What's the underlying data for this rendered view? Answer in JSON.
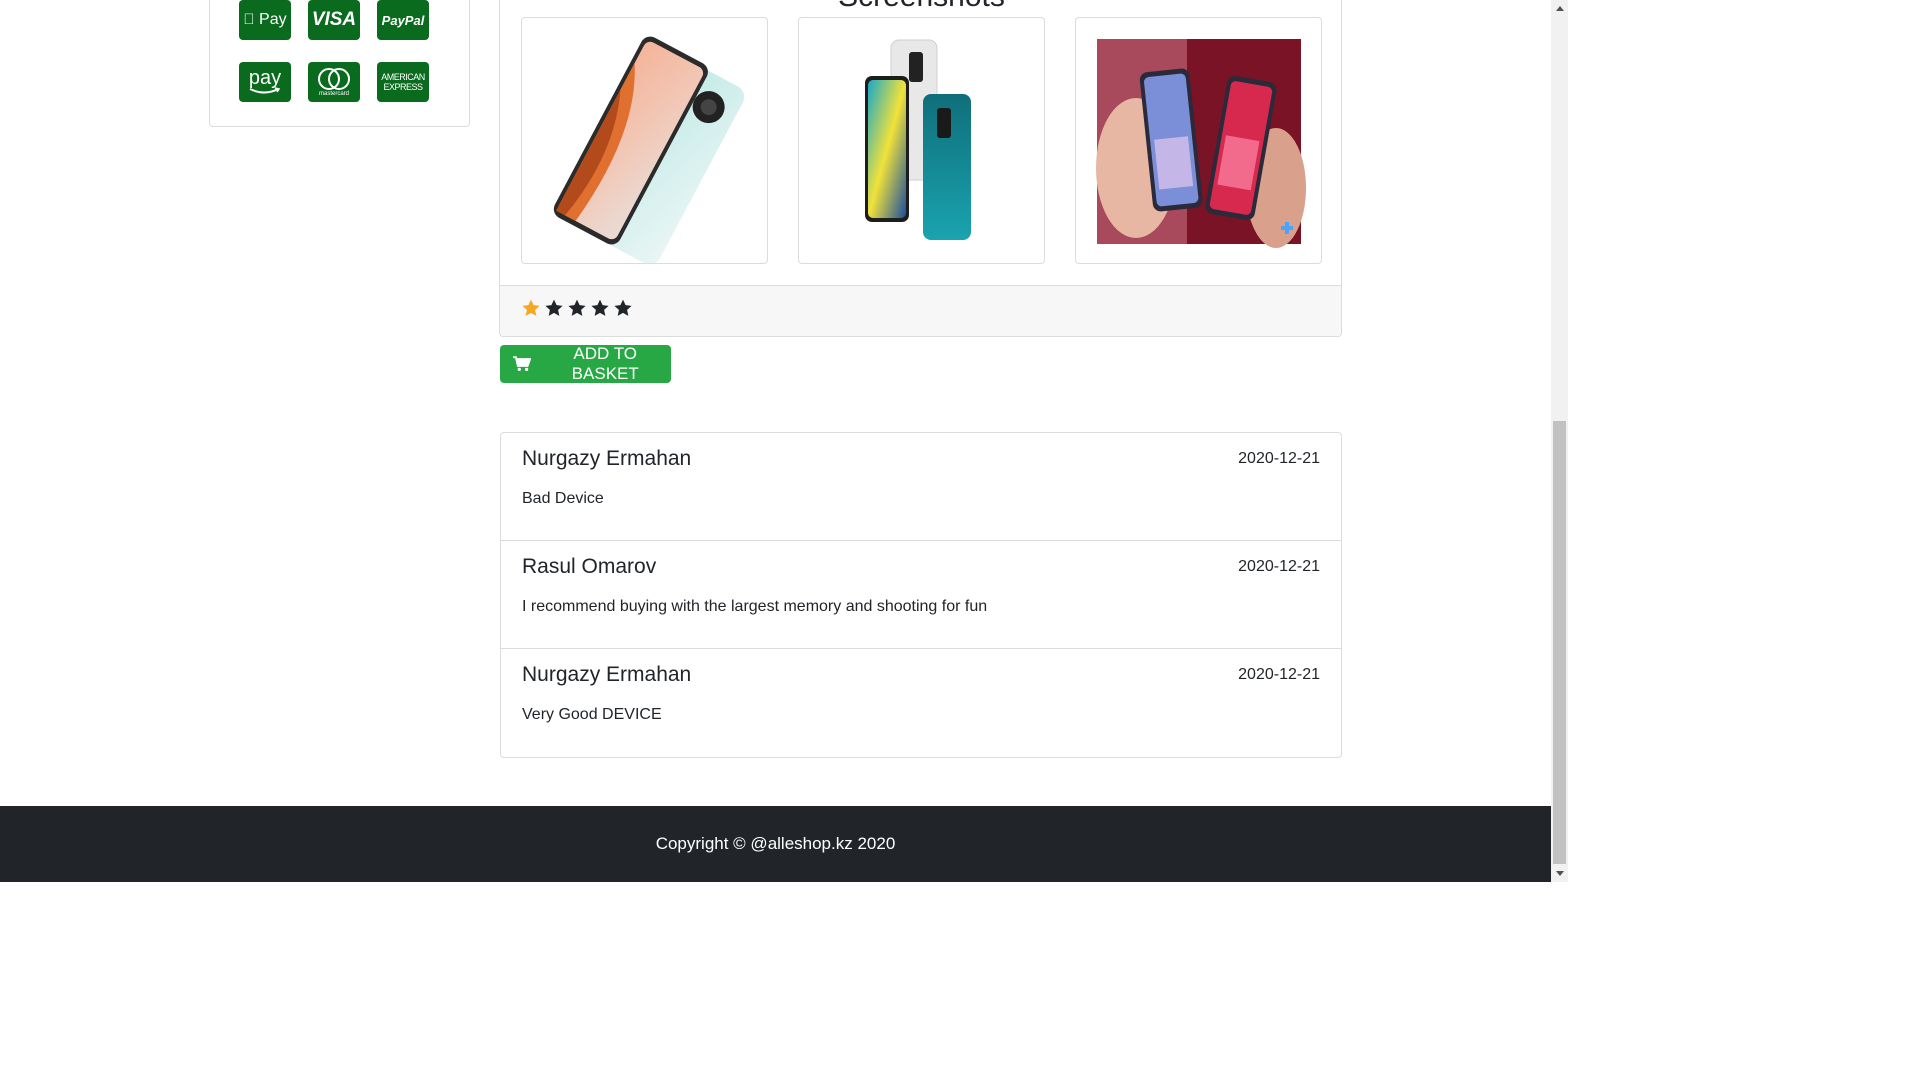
{
  "sidebar": {
    "payment_icons": [
      {
        "name": "apple-pay-icon",
        "label": " Pay"
      },
      {
        "name": "visa-icon",
        "label": "VISA"
      },
      {
        "name": "paypal-icon",
        "label": "PayPal"
      },
      {
        "name": "amazon-pay-icon",
        "label": "pay"
      },
      {
        "name": "mastercard-icon",
        "label": "mastercard"
      },
      {
        "name": "american-express-icon",
        "label": "AMERICAN EXPRESS"
      }
    ]
  },
  "product": {
    "screenshots_title": "Screenshots",
    "rating": {
      "value": 1,
      "max": 5
    },
    "colors": {
      "star_active": "#f5a623",
      "star_inactive": "#212529",
      "button": "#28a745",
      "payment_bg": "#0a6b1e"
    },
    "add_to_basket_label": "ADD TO BASKET"
  },
  "reviews": [
    {
      "author": "Nurgazy Ermahan",
      "date": "2020-12-21",
      "text": "Bad Device"
    },
    {
      "author": "Rasul Omarov",
      "date": "2020-12-21",
      "text": "I recommend buying with the largest memory and shooting for fun"
    },
    {
      "author": "Nurgazy Ermahan",
      "date": "2020-12-21",
      "text": "Very Good DEVICE"
    }
  ],
  "footer": {
    "copyright": "Copyright © @alleshop.kz 2020"
  }
}
